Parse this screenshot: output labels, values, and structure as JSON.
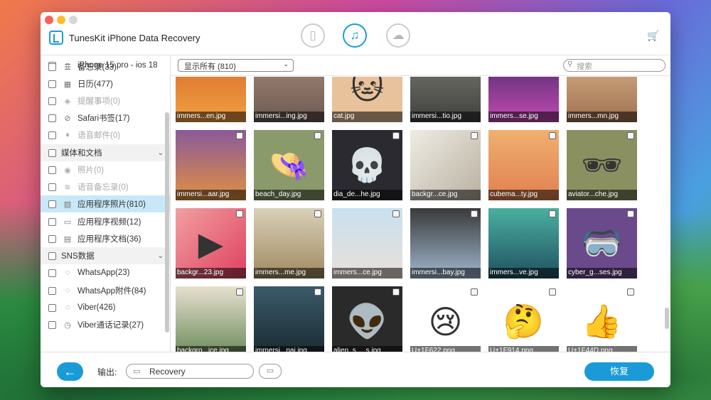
{
  "app": {
    "title": "TunesKit iPhone Data Recovery"
  },
  "colors": {
    "accent": "#1a9bd7",
    "selected_row": "#c8e8f7",
    "cart": "#f0b400"
  },
  "modes": [
    {
      "name": "ios-device-icon",
      "active": false
    },
    {
      "name": "itunes-icon",
      "active": true
    },
    {
      "name": "icloud-icon",
      "active": false
    }
  ],
  "sidebar": {
    "items": [
      {
        "label": "iPhone 15 pro - ios 18",
        "icon": "phone-icon",
        "type": "device"
      },
      {
        "label": "备忘录(33)",
        "icon": "notes-icon",
        "type": "item"
      },
      {
        "label": "日历(477)",
        "icon": "calendar-icon",
        "type": "item"
      },
      {
        "label": "提醒事项(0)",
        "icon": "reminder-icon",
        "type": "disabled"
      },
      {
        "label": "Safari书签(17)",
        "icon": "safari-icon",
        "type": "item"
      },
      {
        "label": "语音邮件(0)",
        "icon": "voicemail-icon",
        "type": "disabled"
      },
      {
        "label": "媒体和文档",
        "icon": "",
        "type": "category"
      },
      {
        "label": "照片(0)",
        "icon": "camera-icon",
        "type": "disabled"
      },
      {
        "label": "语音备忘录(0)",
        "icon": "waveform-icon",
        "type": "disabled"
      },
      {
        "label": "应用程序照片(810)",
        "icon": "photo-icon",
        "type": "active"
      },
      {
        "label": "应用程序视频(12)",
        "icon": "video-icon",
        "type": "item"
      },
      {
        "label": "应用程序文档(36)",
        "icon": "document-icon",
        "type": "item"
      },
      {
        "label": "SNS数据",
        "icon": "",
        "type": "category"
      },
      {
        "label": "WhatsApp(23)",
        "icon": "whatsapp-icon",
        "type": "item"
      },
      {
        "label": "WhatsApp附件(84)",
        "icon": "whatsapp-icon",
        "type": "item"
      },
      {
        "label": "Viber(426)",
        "icon": "viber-icon",
        "type": "item"
      },
      {
        "label": "Viber通话记录(27)",
        "icon": "clock-icon",
        "type": "item"
      }
    ]
  },
  "toolbar": {
    "filter_value": "显示所有 (810)",
    "search_placeholder": "搜索"
  },
  "photos": [
    {
      "name": "immers...en.jpg",
      "bg": "linear-gradient(180deg,#d86a2a,#f0a040)",
      "art": ""
    },
    {
      "name": "immersi...ing.jpg",
      "bg": "linear-gradient(180deg,#a88a7a,#6b5a50)",
      "art": ""
    },
    {
      "name": "cat.jpg",
      "bg": "#e8c29a",
      "art": "🐱"
    },
    {
      "name": "immersi...tio.jpg",
      "bg": "linear-gradient(180deg,#7a7a70,#404040)",
      "art": ""
    },
    {
      "name": "immers...se.jpg",
      "bg": "linear-gradient(180deg,#4a2a6a,#c04ab0)",
      "art": ""
    },
    {
      "name": "immers...mn.jpg",
      "bg": "linear-gradient(180deg,#d8b48a,#a07050)",
      "art": ""
    },
    {
      "name": "immersi...aar.jpg",
      "bg": "linear-gradient(180deg,#8a5a9a,#e09040)",
      "art": ""
    },
    {
      "name": "beach_day.jpg",
      "bg": "#8a9a6a",
      "art": "👒"
    },
    {
      "name": "dia_de...he.jpg",
      "bg": "#2a2a30",
      "art": "💀"
    },
    {
      "name": "backgr...ce.jpg",
      "bg": "linear-gradient(135deg,#f0ece4,#b8b0a0)",
      "art": ""
    },
    {
      "name": "cubema...ty.jpg",
      "bg": "linear-gradient(180deg,#f0b070,#e08050)",
      "art": ""
    },
    {
      "name": "aviator...che.jpg",
      "bg": "#8a9060",
      "art": "🕶"
    },
    {
      "name": "backgr...23.jpg",
      "bg": "linear-gradient(135deg,#f0a0a0,#e04060)",
      "art": "▶"
    },
    {
      "name": "immers...me.jpg",
      "bg": "linear-gradient(180deg,#d8d0b8,#a08a60)",
      "art": ""
    },
    {
      "name": "immers...ce.jpg",
      "bg": "linear-gradient(180deg,#c8e0f0,#e8e0d8)",
      "art": ""
    },
    {
      "name": "immersi...bay.jpg",
      "bg": "linear-gradient(180deg,#3a3a3a,#a0b8d0)",
      "art": ""
    },
    {
      "name": "immers...ve.jpg",
      "bg": "linear-gradient(180deg,#4ab0a0,#205060)",
      "art": ""
    },
    {
      "name": "cyber_g...ses.jpg",
      "bg": "#6a4a8a",
      "art": "🥽"
    },
    {
      "name": "backgro...ice.jpg",
      "bg": "linear-gradient(180deg,#e8e0d0,#6a8a5a)",
      "art": ""
    },
    {
      "name": "immersi...nai.jpg",
      "bg": "linear-gradient(180deg,#3a5a6a,#1a2a30)",
      "art": ""
    },
    {
      "name": "alien_s..._s.jpg",
      "bg": "#2a2a2a",
      "art": "👽"
    },
    {
      "name": "U+1F622.png",
      "bg": "#ffffff",
      "art": "😢"
    },
    {
      "name": "U+1F914.png",
      "bg": "#ffffff",
      "art": "🤔"
    },
    {
      "name": "U+1F44D.png",
      "bg": "#ffffff",
      "art": "👍"
    }
  ],
  "footer": {
    "output_label": "输出:",
    "output_path": "Recovery",
    "recover_label": "恢复"
  }
}
